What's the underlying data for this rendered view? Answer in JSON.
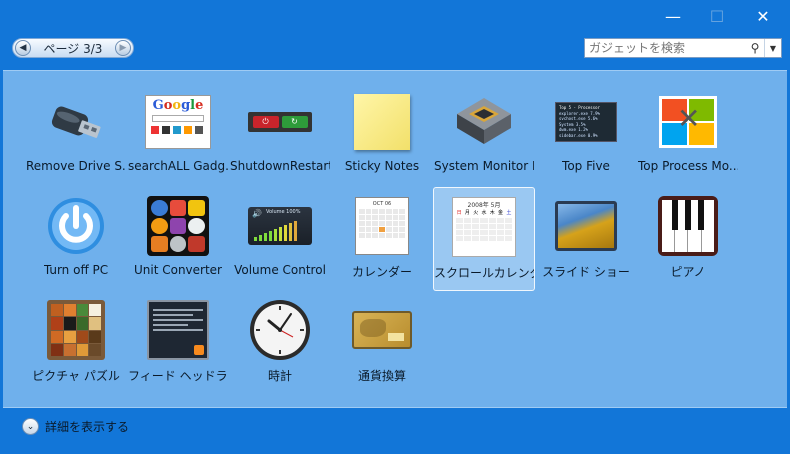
{
  "window": {
    "minimize_icon": "minimize-icon",
    "maximize_icon": "maximize-icon",
    "close_icon": "close-icon"
  },
  "toolbar": {
    "page_label": "ページ 3/3",
    "search_placeholder": "ガジェットを検索"
  },
  "gadgets": [
    {
      "label": "Remove Drive S...",
      "icon": "usb-drive-icon"
    },
    {
      "label": "searchALL Gadg...",
      "icon": "google-search-icon"
    },
    {
      "label": "ShutdownRestart",
      "icon": "shutdown-restart-icon"
    },
    {
      "label": "Sticky Notes",
      "icon": "sticky-note-icon"
    },
    {
      "label": "System Monitor II",
      "icon": "cpu-chip-icon"
    },
    {
      "label": "Top Five",
      "icon": "top-five-icon"
    },
    {
      "label": "Top Process Mo...",
      "icon": "top-process-icon"
    },
    {
      "label": "Turn off PC",
      "icon": "power-icon"
    },
    {
      "label": "Unit Converter",
      "icon": "unit-converter-icon"
    },
    {
      "label": "Volume Control",
      "icon": "volume-icon"
    },
    {
      "label": "カレンダー",
      "icon": "calendar-icon"
    },
    {
      "label": "スクロールカレンダー",
      "icon": "scroll-calendar-icon",
      "selected": true
    },
    {
      "label": "スライド ショー",
      "icon": "slideshow-icon"
    },
    {
      "label": "ピアノ",
      "icon": "piano-icon"
    },
    {
      "label": "ピクチャ パズル",
      "icon": "picture-puzzle-icon"
    },
    {
      "label": "フィード ヘッドライン",
      "icon": "feed-headlines-icon"
    },
    {
      "label": "時計",
      "icon": "clock-icon"
    },
    {
      "label": "通貨換算",
      "icon": "currency-icon"
    }
  ],
  "preview_text": {
    "google": "Google",
    "calendar_month": "OCT 06",
    "volume": "Volume 100%",
    "topfive": [
      "Top 5 - Processor",
      "explorer.exe 7.9%",
      "svchost.exe 5.6%",
      "System 3.5%",
      "dwm.exe 1.2%",
      "sidebar.exe 0.9%"
    ],
    "scroll_cal": "2008年 5月",
    "weekdays": [
      "日",
      "月",
      "火",
      "水",
      "木",
      "金",
      "土"
    ]
  },
  "footer": {
    "details_label": "詳細を表示する"
  }
}
